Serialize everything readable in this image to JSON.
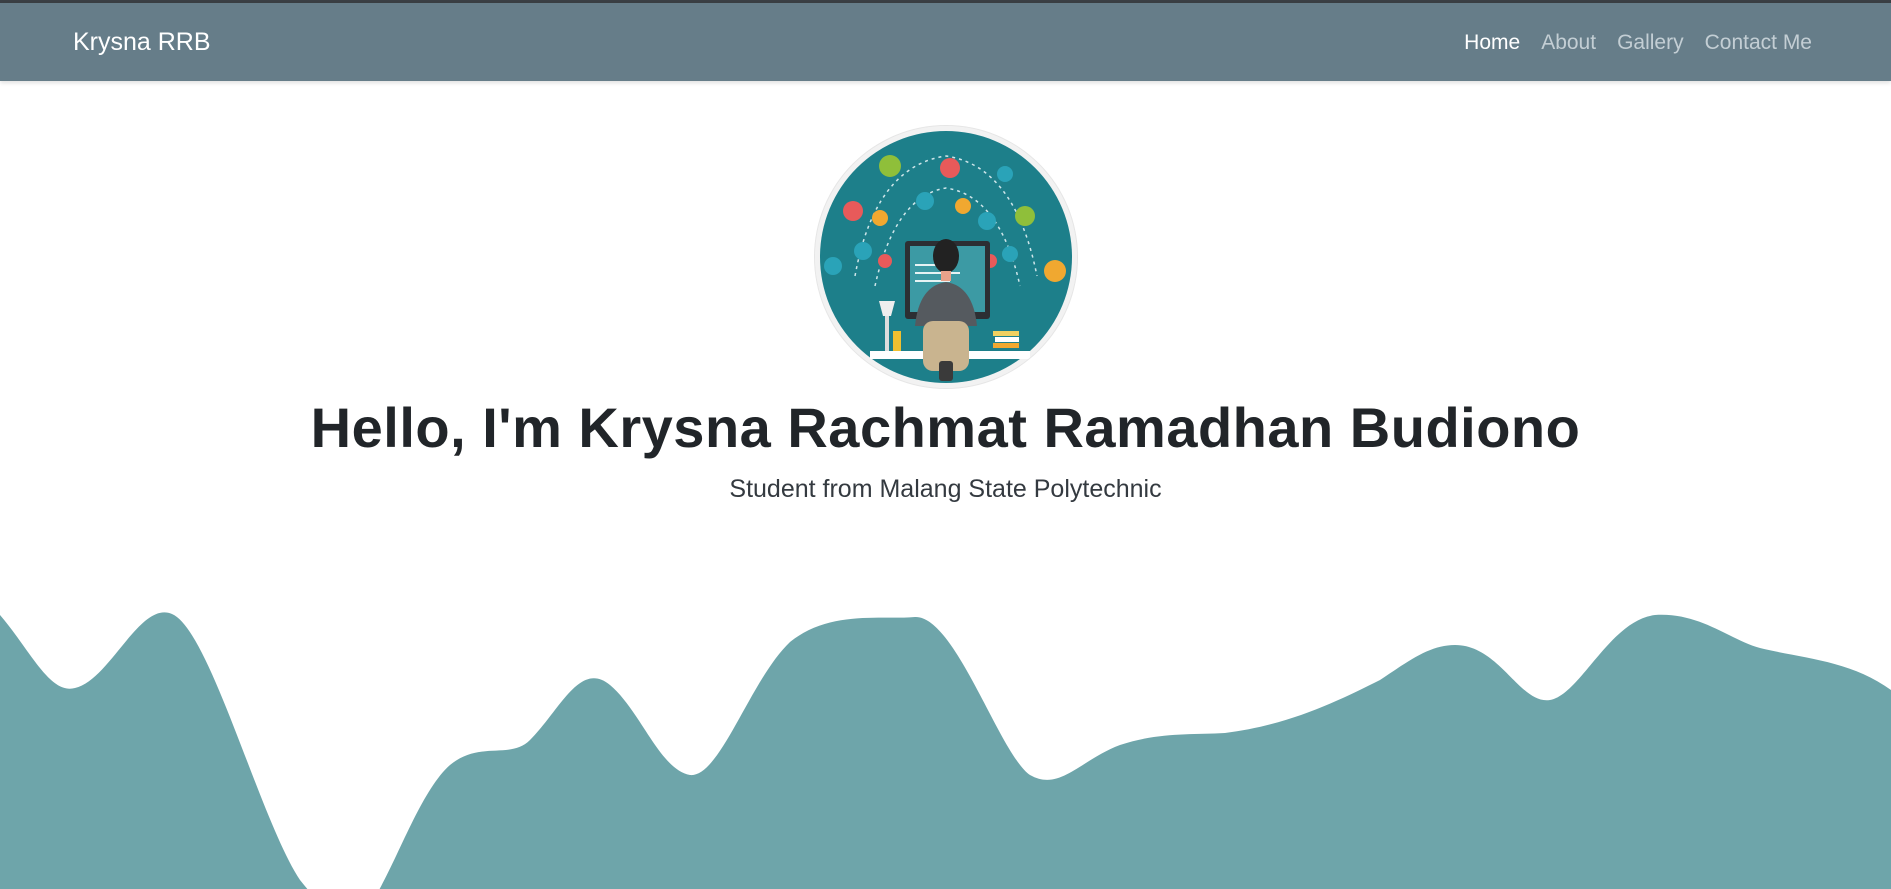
{
  "navbar": {
    "brand": "Krysna RRB",
    "links": [
      {
        "label": "Home",
        "active": true
      },
      {
        "label": "About",
        "active": false
      },
      {
        "label": "Gallery",
        "active": false
      },
      {
        "label": "Contact Me",
        "active": false
      }
    ]
  },
  "hero": {
    "avatar_icon": "developer-illustration-icon",
    "title": "Hello, I'm Krysna Rachmat Ramadhan Budiono",
    "subtitle": "Student from Malang State Polytechnic"
  },
  "colors": {
    "navbar": "#667d89",
    "wave": "#6ea5aa",
    "avatar_bg": "#1d7f8a"
  }
}
